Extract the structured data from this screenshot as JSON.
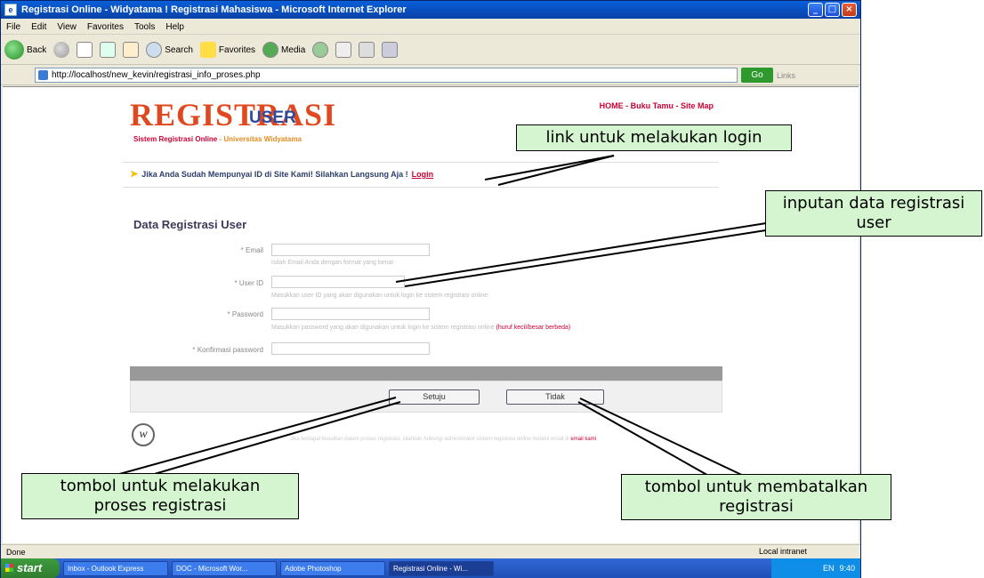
{
  "window": {
    "title": "Registrasi Online - Widyatama ! Registrasi Mahasiswa - Microsoft Internet Explorer",
    "controls": [
      "_",
      "□",
      "×"
    ]
  },
  "menubar": [
    "File",
    "Edit",
    "View",
    "Favorites",
    "Tools",
    "Help"
  ],
  "toolbar": {
    "back": "Back",
    "search": "Search",
    "favorites": "Favorites",
    "media": "Media"
  },
  "address": {
    "url": "http://localhost/new_kevin/registrasi_info_proses.php",
    "go": "Go",
    "links": "Links"
  },
  "page": {
    "top_links": "HOME - Buku Tamu - Site Map",
    "logo_main": "REGISTRASI",
    "logo_user": "USER",
    "logo_sub": "Sistem Registrasi Online",
    "logo_sub2": "- Universitas Widyatama",
    "login_prompt": "Jika Anda Sudah Mempunyai ID di Site Kami! Silahkan Langsung Aja !",
    "login_link": "Login",
    "form_title": "Data Registrasi User",
    "fields": [
      {
        "label": "* Email",
        "hint": "Isilah Email Anda dengan format yang benar"
      },
      {
        "label": "* User ID",
        "hint": "Masukkan user ID yang akan digunakan untuk login ke sistem registrasi online"
      },
      {
        "label": "* Password",
        "hint": "Masukkan password yang akan digunakan untuk login ke sistem registrasi online",
        "warn": "(huruf kecil/besar berbeda)"
      },
      {
        "label": "* Konfirmasi password",
        "hint": ""
      }
    ],
    "submit_label": "Setuju",
    "cancel_label": "Tidak",
    "footnote": "Jika terdapat kesulitan dalam proses registrasi, silahkan hubungi administrator sistem registrasi online melalui email di",
    "footnote_link": "email kami"
  },
  "status": {
    "left": "Done",
    "zone": "Local intranet"
  },
  "taskbar": {
    "start": "start",
    "tasks": [
      "Inbox - Outlook Express",
      "DOC - Microsoft Wor...",
      "Adobe Photoshop",
      "Registrasi Online - Wi..."
    ],
    "tray": "EN",
    "clock": "9:40"
  },
  "annotations": {
    "login": "link untuk melakukan login",
    "input_line1": "inputan data registrasi",
    "input_line2": "user",
    "submit_line1": "tombol untuk melakukan",
    "submit_line2": "proses registrasi",
    "cancel_line1": "tombol untuk membatalkan",
    "cancel_line2": "registrasi"
  }
}
